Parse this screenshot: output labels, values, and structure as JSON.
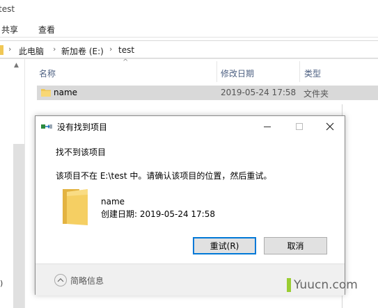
{
  "window": {
    "title_fragment": "test"
  },
  "ribbon": {
    "tabs": [
      "共享",
      "查看"
    ]
  },
  "breadcrumb": {
    "items": [
      "此电脑",
      "新加卷 (E:)",
      "test"
    ]
  },
  "file_list": {
    "columns": [
      "名称",
      "修改日期",
      "类型"
    ],
    "rows": [
      {
        "name": "name",
        "modified": "2019-05-24 17:58",
        "type": "文件夹"
      }
    ]
  },
  "nav_pane": {
    "fragment": ")"
  },
  "dialog": {
    "title": "没有找到项目",
    "heading": "找不到该项目",
    "message": "该项目不在 E:\\test 中。请确认该项目的位置，然后重试。",
    "item_name": "name",
    "item_created": "创建日期: 2019-05-24 17:58",
    "retry_label": "重试(R)",
    "cancel_label": "取消",
    "details_label": "简略信息"
  },
  "watermark": {
    "text": "Yuucn.com"
  },
  "colors": {
    "folder": "#f0c755",
    "accent": "#0078d7",
    "watermark": "#9acd32"
  }
}
